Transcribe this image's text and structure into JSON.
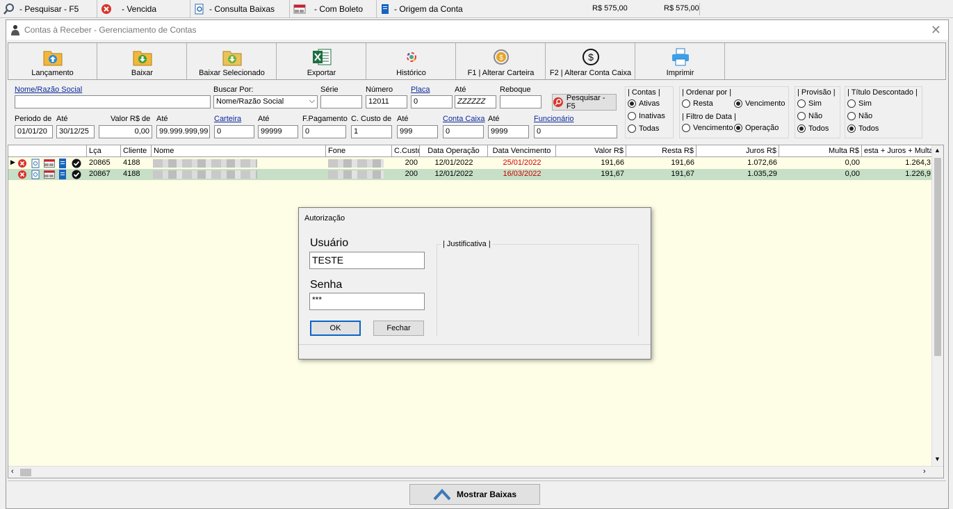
{
  "topbar": {
    "items": [
      {
        "icon": "magnifier-icon",
        "label": "- Pesquisar - F5"
      },
      {
        "icon": "red-x-icon",
        "label": "- Vencida"
      },
      {
        "icon": "consult-icon",
        "label": "- Consulta Baixas"
      },
      {
        "icon": "boleto-icon",
        "label": "- Com Boleto"
      },
      {
        "icon": "document-icon",
        "label": "- Origem da Conta"
      }
    ],
    "amount1": "R$ 575,00",
    "amount2": "R$ 575,00"
  },
  "window": {
    "title": "Contas à Receber - Gerenciamento de Contas"
  },
  "toolbar": {
    "buttons": [
      {
        "label": "Lançamento",
        "icon": "folder-up-icon"
      },
      {
        "label": "Baixar",
        "icon": "folder-down-icon"
      },
      {
        "label": "Baixar Selecionado",
        "icon": "folder-down-selected-icon"
      },
      {
        "label": "Exportar",
        "icon": "excel-icon"
      },
      {
        "label": "Histórico",
        "icon": "history-icon"
      },
      {
        "label": "F1 | Alterar Carteira",
        "icon": "coin-cycle-icon"
      },
      {
        "label": "F2 | Alterar Conta Caixa",
        "icon": "dollar-cycle-icon"
      },
      {
        "label": "Imprimir",
        "icon": "printer-icon"
      }
    ]
  },
  "filters": {
    "nome_label": "Nome/Razão Social",
    "nome_value": "",
    "buscar_label": "Buscar Por:",
    "buscar_value": "Nome/Razão Social",
    "serie_label": "Série",
    "serie_value": "",
    "numero_label": "Número",
    "numero_value": "12011",
    "placa_label": "Placa",
    "placa_value": "0",
    "ate_placa_label": "Até",
    "ate_placa_value": "ZZZZZZ",
    "reboque_label": "Reboque",
    "reboque_value": "",
    "pesquisar_button": "Pesquisar - F5",
    "periodo_label": "Periodo de",
    "periodo_value": "01/01/20",
    "ate_periodo_label": "Até",
    "ate_periodo_value": "30/12/25",
    "valor_label": "Valor R$ de",
    "valor_value": "0,00",
    "ate_valor_label": "Até",
    "ate_valor_value": "99.999.999,99",
    "carteira_label": "Carteira",
    "carteira_value": "0",
    "ate_carteira_label": "Até",
    "ate_carteira_value": "99999",
    "fpag_label": "F.Pagamento",
    "fpag_value": "0",
    "ccusto_label": "C. Custo de",
    "ccusto_value": "1",
    "ate_ccusto_label": "Até",
    "ate_ccusto_value": "999",
    "contacaixa_label": "Conta Caixa",
    "contacaixa_value": "0",
    "ate_contacaixa_label": "Até",
    "ate_contacaixa_value": "9999",
    "funcionario_label": "Funcionário",
    "funcionario_value": "0"
  },
  "groups": {
    "contas": {
      "title": "| Contas |",
      "options": [
        "Ativas",
        "Inativas",
        "Todas"
      ],
      "selected": "Ativas"
    },
    "ordenar": {
      "title": "| Ordenar por |",
      "options": [
        "Resta",
        "Vencimento"
      ],
      "selected": "Vencimento"
    },
    "filtro_data": {
      "title": "| Filtro de Data |",
      "options": [
        "Vencimento",
        "Operação"
      ],
      "selected": "Operação"
    },
    "provisao": {
      "title": "| Provisão |",
      "options": [
        "Sim",
        "Não",
        "Todos"
      ],
      "selected": "Todos"
    },
    "titulo_desc": {
      "title": "| Título Descontado |",
      "options": [
        "Sim",
        "Não",
        "Todos"
      ],
      "selected": "Todos"
    }
  },
  "grid": {
    "headers": [
      "Lça",
      "Cliente",
      "Nome",
      "Fone",
      "C.Custo",
      "Data Operação",
      "Data Vencimento",
      "Valor R$",
      "Resta R$",
      "Juros R$",
      "Multa R$",
      "esta + Juros + Multa"
    ],
    "rows": [
      {
        "lca": "20865",
        "cliente": "4188",
        "ccusto": "200",
        "data_op": "12/01/2022",
        "data_venc": "25/01/2022",
        "valor": "191,66",
        "resta": "191,66",
        "juros": "1.072,66",
        "multa": "0,00",
        "total": "1.264,3"
      },
      {
        "lca": "20867",
        "cliente": "4188",
        "ccusto": "200",
        "data_op": "12/01/2022",
        "data_venc": "16/03/2022",
        "valor": "191,67",
        "resta": "191,67",
        "juros": "1.035,29",
        "multa": "0,00",
        "total": "1.226,9"
      }
    ]
  },
  "dialog": {
    "title": "Autorização",
    "usuario_label": "Usuário",
    "usuario_value": "TESTE",
    "senha_label": "Senha",
    "senha_value": "***",
    "justificativa_label": "| Justificativa |",
    "ok_button": "OK",
    "fechar_button": "Fechar"
  },
  "bottom": {
    "mostrar_baixas": "Mostrar Baixas"
  },
  "colors": {
    "grid_background": "#fefde5",
    "selected_row": "#c6dfc6",
    "overdue_text": "#d00000",
    "link": "#0b2a9e"
  }
}
